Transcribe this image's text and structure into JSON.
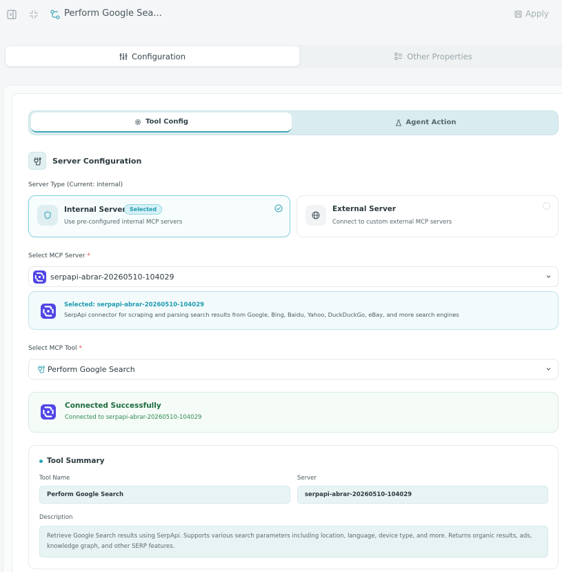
{
  "header": {
    "title": "Perform Google Sea...",
    "apply_label": "Apply"
  },
  "tabs": {
    "configuration": "Configuration",
    "other_properties": "Other Properties"
  },
  "subtabs": {
    "tool_config": "Tool Config",
    "agent_action": "Agent Action"
  },
  "server_config": {
    "heading": "Server Configuration",
    "server_type_label": "Server Type (Current: internal)",
    "internal": {
      "name": "Internal Server",
      "badge": "Selected",
      "description": "Use pre-configured internal MCP servers"
    },
    "external": {
      "name": "External Server",
      "description": "Connect to custom external MCP servers"
    }
  },
  "mcp_server": {
    "label": "Select MCP Server",
    "required_mark": "*",
    "value": "serpapi-abrar-20260510-104029",
    "selected_title": "Selected: serpapi-abrar-20260510-104029",
    "selected_description": "SerpApi connector for scraping and parsing search results from Google, Bing, Baidu, Yahoo, DuckDuckGo, eBay, and more search engines"
  },
  "mcp_tool": {
    "label": "Select MCP Tool",
    "required_mark": "*",
    "value": "Perform Google Search"
  },
  "connection": {
    "title": "Connected Successfully",
    "detail": "Connected to serpapi-abrar-20260510-104029"
  },
  "tool_summary": {
    "heading": "Tool Summary",
    "tool_name_label": "Tool Name",
    "tool_name": "Perform Google Search",
    "server_label": "Server",
    "server": "serpapi-abrar-20260510-104029",
    "description_label": "Description",
    "description": "Retrieve Google Search results using SerpApi. Supports various search parameters including location, language, device type, and more. Returns organic results, ads, knowledge graph, and other SERP features."
  },
  "colors": {
    "accent": "#2aa6b8",
    "success": "#1c6b3c",
    "required": "#e0474c"
  }
}
